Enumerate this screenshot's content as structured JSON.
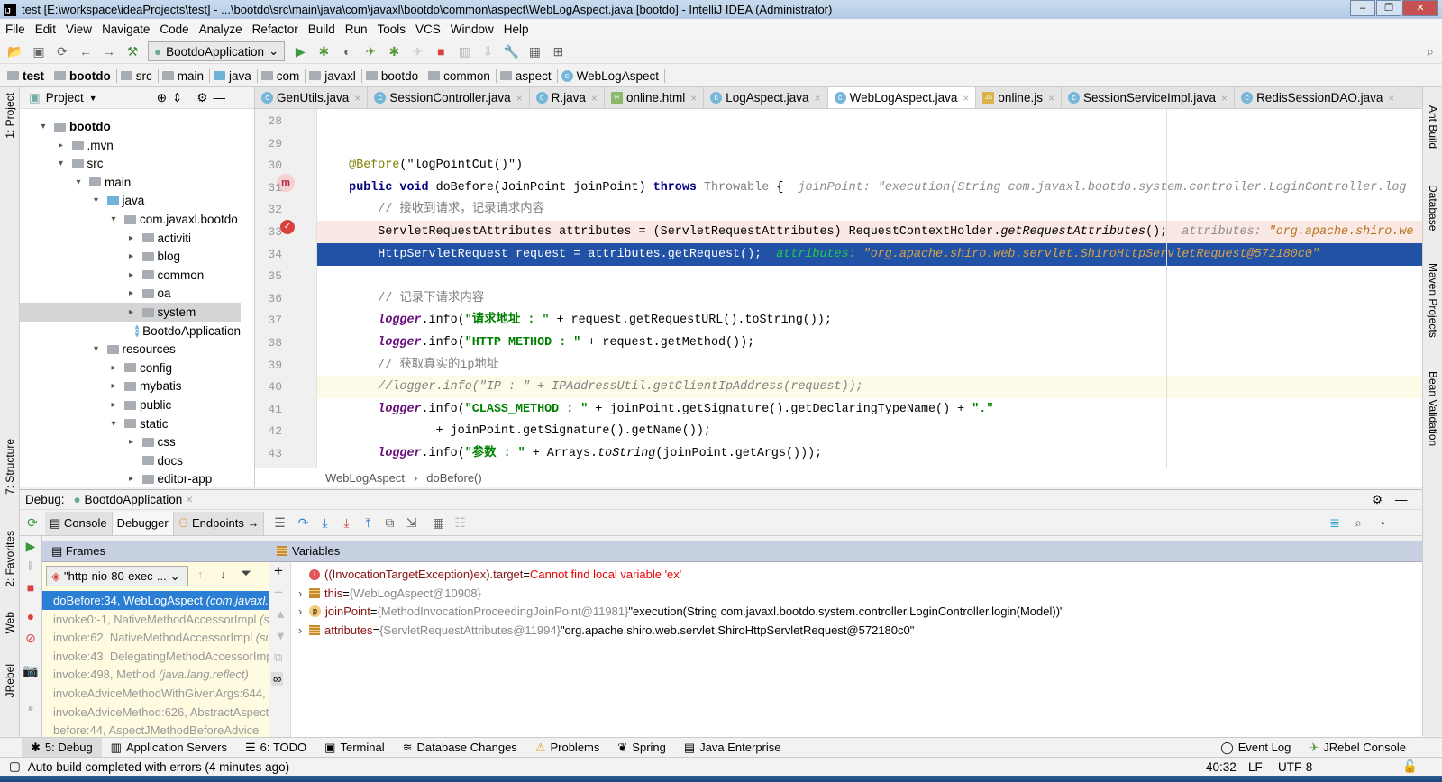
{
  "window": {
    "title": "test [E:\\workspace\\ideaProjects\\test] - ...\\bootdo\\src\\main\\java\\com\\javaxl\\bootdo\\common\\aspect\\WebLogAspect.java [bootdo] - IntelliJ IDEA (Administrator)",
    "logo": "IJ"
  },
  "menu": [
    "File",
    "Edit",
    "View",
    "Navigate",
    "Code",
    "Analyze",
    "Refactor",
    "Build",
    "Run",
    "Tools",
    "VCS",
    "Window",
    "Help"
  ],
  "toolbar": {
    "run_config": "BootdoApplication"
  },
  "navbar": [
    "test",
    "bootdo",
    "src",
    "main",
    "java",
    "com",
    "javaxl",
    "bootdo",
    "common",
    "aspect",
    "WebLogAspect"
  ],
  "left_stripe": [
    "1: Project",
    "7: Structure",
    "2: Favorites",
    "Web",
    "JRebel"
  ],
  "right_stripe": [
    "Ant Build",
    "Database",
    "Maven Projects",
    "Bean Validation"
  ],
  "project": {
    "title": "Project",
    "tree": [
      {
        "label": "bootdo",
        "level": 0,
        "state": "open",
        "type": "module",
        "bold": true
      },
      {
        "label": ".mvn",
        "level": 1,
        "state": "closed",
        "type": "folder"
      },
      {
        "label": "src",
        "level": 1,
        "state": "open",
        "type": "folder"
      },
      {
        "label": "main",
        "level": 2,
        "state": "open",
        "type": "folder"
      },
      {
        "label": "java",
        "level": 3,
        "state": "open",
        "type": "source"
      },
      {
        "label": "com.javaxl.bootdo",
        "level": 4,
        "state": "open",
        "type": "package"
      },
      {
        "label": "activiti",
        "level": 5,
        "state": "closed",
        "type": "package"
      },
      {
        "label": "blog",
        "level": 5,
        "state": "closed",
        "type": "package"
      },
      {
        "label": "common",
        "level": 5,
        "state": "closed",
        "type": "package"
      },
      {
        "label": "oa",
        "level": 5,
        "state": "closed",
        "type": "package"
      },
      {
        "label": "system",
        "level": 5,
        "state": "closed",
        "type": "package",
        "selected": true
      },
      {
        "label": "BootdoApplication",
        "level": 5,
        "state": "none",
        "type": "class"
      },
      {
        "label": "resources",
        "level": 3,
        "state": "open",
        "type": "folder"
      },
      {
        "label": "config",
        "level": 4,
        "state": "closed",
        "type": "folder"
      },
      {
        "label": "mybatis",
        "level": 4,
        "state": "closed",
        "type": "folder"
      },
      {
        "label": "public",
        "level": 4,
        "state": "closed",
        "type": "folder"
      },
      {
        "label": "static",
        "level": 4,
        "state": "open",
        "type": "folder"
      },
      {
        "label": "css",
        "level": 5,
        "state": "closed",
        "type": "folder"
      },
      {
        "label": "docs",
        "level": 5,
        "state": "none",
        "type": "folder"
      },
      {
        "label": "editor-app",
        "level": 5,
        "state": "closed",
        "type": "folder"
      }
    ]
  },
  "editor": {
    "tabs": [
      {
        "label": "GenUtils.java",
        "icon": "class"
      },
      {
        "label": "SessionController.java",
        "icon": "class"
      },
      {
        "label": "R.java",
        "icon": "class"
      },
      {
        "label": "online.html",
        "icon": "html"
      },
      {
        "label": "LogAspect.java",
        "icon": "class"
      },
      {
        "label": "WebLogAspect.java",
        "icon": "class",
        "active": true
      },
      {
        "label": "online.js",
        "icon": "js"
      },
      {
        "label": "SessionServiceImpl.java",
        "icon": "class"
      },
      {
        "label": "RedisSessionDAO.java",
        "icon": "class"
      }
    ],
    "lines": [
      {
        "n": "28",
        "tokens": []
      },
      {
        "n": "29",
        "tokens": []
      },
      {
        "n": "30",
        "tokens": [
          [
            "    "
          ],
          [
            "@Before",
            "ann"
          ],
          [
            "(\"logPointCut()\")"
          ]
        ]
      },
      {
        "n": "31",
        "tokens": [
          [
            "    "
          ],
          [
            "public void",
            "kw"
          ],
          [
            " doBefore(JoinPoint joinPoint) "
          ],
          [
            "throws",
            "kw"
          ],
          [
            " "
          ],
          [
            "Throwable",
            "gray"
          ],
          [
            " {  "
          ],
          [
            "joinPoint: ",
            "hint"
          ],
          [
            "\"execution(String com.javaxl.bootdo.system.controller.LoginController.log",
            "hint"
          ]
        ]
      },
      {
        "n": "32",
        "tokens": [
          [
            "        "
          ],
          [
            "// 接收到请求，记录请求内容",
            "cmn"
          ]
        ]
      },
      {
        "n": "33",
        "kind": "err",
        "tokens": [
          [
            "        ServletRequestAttributes attributes = (ServletRequestAttributes) RequestContextHolder."
          ],
          [
            "getRequestAttributes",
            "st"
          ],
          [
            "();  "
          ],
          [
            "attributes: ",
            "hint"
          ],
          [
            "\"org.apache.shiro.we",
            "hintv"
          ]
        ]
      },
      {
        "n": "34",
        "kind": "exec",
        "tokens": [
          [
            "        HttpServletRequest request = attributes.getRequest();  "
          ],
          [
            "attributes: ",
            "hintg"
          ],
          [
            "\"org.apache.shiro.web.servlet.ShiroHttpServletRequest@572180c0\"",
            "hintv"
          ]
        ]
      },
      {
        "n": "35",
        "tokens": []
      },
      {
        "n": "36",
        "tokens": [
          [
            "        "
          ],
          [
            "// 记录下请求内容",
            "cmn"
          ]
        ]
      },
      {
        "n": "37",
        "tokens": [
          [
            "        "
          ],
          [
            "logger",
            "fld"
          ],
          [
            ".info("
          ],
          [
            "\"请求地址 : \"",
            "str"
          ],
          [
            " + request.getRequestURL().toString());"
          ]
        ]
      },
      {
        "n": "38",
        "tokens": [
          [
            "        "
          ],
          [
            "logger",
            "fld"
          ],
          [
            ".info("
          ],
          [
            "\"HTTP METHOD : \"",
            "str"
          ],
          [
            " + request.getMethod());"
          ]
        ]
      },
      {
        "n": "39",
        "tokens": [
          [
            "        "
          ],
          [
            "// 获取真实的ip地址",
            "cmn"
          ]
        ]
      },
      {
        "n": "40",
        "kind": "caret",
        "tokens": [
          [
            "        "
          ],
          [
            "//logger.info(\"IP : \" + IPAddressUtil.getClientIpAddress(request));",
            "cm"
          ]
        ]
      },
      {
        "n": "41",
        "tokens": [
          [
            "        "
          ],
          [
            "logger",
            "fld"
          ],
          [
            ".info("
          ],
          [
            "\"CLASS_METHOD : \"",
            "str"
          ],
          [
            " + joinPoint.getSignature().getDeclaringTypeName() + "
          ],
          [
            "\".\"",
            "str"
          ]
        ]
      },
      {
        "n": "42",
        "tokens": [
          [
            "                + joinPoint.getSignature().getName());"
          ]
        ]
      },
      {
        "n": "43",
        "tokens": [
          [
            "        "
          ],
          [
            "logger",
            "fld"
          ],
          [
            ".info("
          ],
          [
            "\"参数 : \"",
            "str"
          ],
          [
            " + Arrays."
          ],
          [
            "toString",
            "st"
          ],
          [
            "(joinPoint.getArgs()));"
          ]
        ]
      }
    ],
    "breadcrumb": [
      "WebLogAspect",
      "doBefore()"
    ]
  },
  "debug": {
    "label": "Debug:",
    "session": "BootdoApplication",
    "tabs": [
      "Console",
      "Debugger",
      "Endpoints"
    ],
    "frames_title": "Frames",
    "variables_title": "Variables",
    "thread": "\"http-nio-80-exec-...",
    "frames": [
      {
        "name": "doBefore:34, WebLogAspect ",
        "pkg": "(com.javaxl.",
        "selected": true
      },
      {
        "name": "invoke0:-1, NativeMethodAccessorImpl ",
        "pkg": "(sun.reflect)"
      },
      {
        "name": "invoke:62, NativeMethodAccessorImpl ",
        "pkg": "(sun.reflect)"
      },
      {
        "name": "invoke:43, DelegatingMethodAccessorImpl",
        "pkg": ""
      },
      {
        "name": "invoke:498, Method ",
        "pkg": "(java.lang.reflect)"
      },
      {
        "name": "invokeAdviceMethodWithGivenArgs:644, ",
        "pkg": ""
      },
      {
        "name": "invokeAdviceMethod:626, AbstractAspect",
        "pkg": ""
      },
      {
        "name": "before:44, AspectJMethodBeforeAdvice",
        "pkg": ""
      }
    ],
    "variables": [
      {
        "kind": "error",
        "name": "((InvocationTargetException)ex).target",
        "eq": " = ",
        "value": "Cannot find local variable 'ex'"
      },
      {
        "kind": "field",
        "expand": true,
        "name": "this",
        "eq": " = ",
        "id": "{WebLogAspect@10908}",
        "value": ""
      },
      {
        "kind": "param",
        "expand": true,
        "name": "joinPoint",
        "eq": " = ",
        "id": "{MethodInvocationProceedingJoinPoint@11981}",
        "value": " \"execution(String com.javaxl.bootdo.system.controller.LoginController.login(Model))\""
      },
      {
        "kind": "field",
        "expand": true,
        "name": "attributes",
        "eq": " = ",
        "id": "{ServletRequestAttributes@11994}",
        "value": " \"org.apache.shiro.web.servlet.ShiroHttpServletRequest@572180c0\""
      }
    ]
  },
  "bottombar": {
    "left": [
      "5: Debug",
      "Application Servers",
      "6: TODO",
      "Terminal",
      "Database Changes",
      "Problems",
      "Spring",
      "Java Enterprise"
    ],
    "right": [
      "Event Log",
      "JRebel Console"
    ]
  },
  "status": {
    "message": "Auto build completed with errors (4 minutes ago)",
    "position": "40:32",
    "line_sep": "LF",
    "encoding": "UTF-8"
  }
}
